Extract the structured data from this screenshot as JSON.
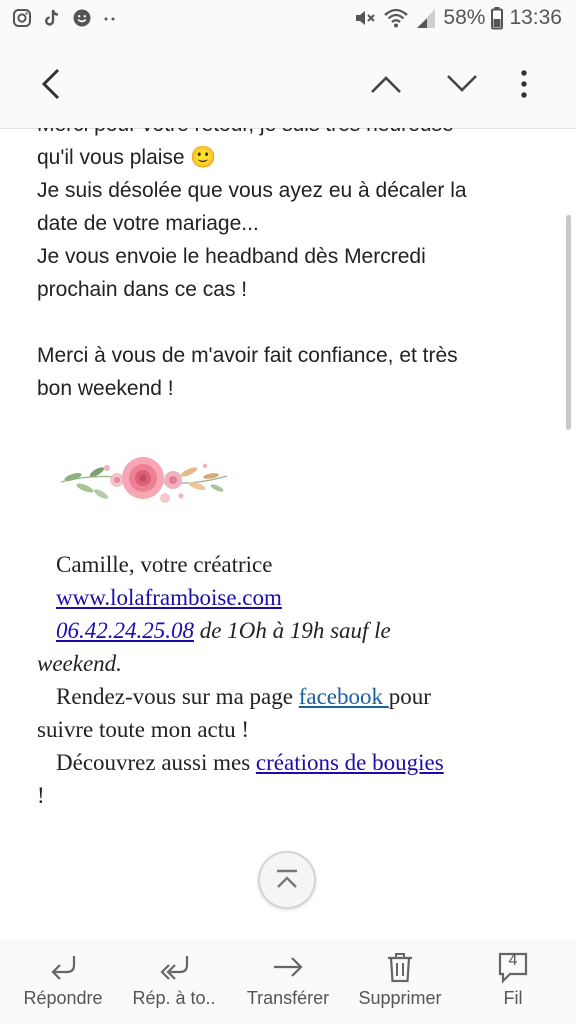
{
  "status_bar": {
    "battery": "58%",
    "time": "13:36",
    "left_icons": [
      "instagram-icon",
      "tiktok-icon",
      "waze-icon",
      "more-dots-icon"
    ],
    "right_icons": [
      "mute-icon",
      "wifi-icon",
      "signal-icon",
      "battery-icon"
    ]
  },
  "toolbar": {
    "icons": [
      "back-arrow-icon",
      "chevron-up-icon",
      "chevron-down-icon",
      "more-vert-icon"
    ]
  },
  "email": {
    "line_partial": "Merci pour votre retour, je suis très heureuse",
    "line1": "qu'il vous plaise 🙂",
    "line2": "Je suis désolée que vous ayez eu à décaler la",
    "line3": "date de votre mariage...",
    "line4": "Je vous envoie le headband dès Mercredi",
    "line5": "prochain dans ce cas !",
    "line6": "Merci à vous de m'avoir fait confiance, et très",
    "line7": "bon weekend !"
  },
  "signature": {
    "name": "Camille, votre créatrice",
    "website": "www.lolaframboise.com",
    "phone": "06.42.24.25.08",
    "hours": " de 1Oh à 19h sauf le",
    "hours_end": "weekend.",
    "fb_pre": "Rendez-vous sur ma page ",
    "fb_link": "facebook ",
    "fb_post": "pour",
    "fb_end": "suivre toute mon actu !",
    "candles_pre": "Découvrez aussi mes ",
    "candles_link": "créations de bougies",
    "candles_end": "!"
  },
  "bottom_bar": {
    "reply": "Répondre",
    "reply_all": "Rép. à to..",
    "forward": "Transférer",
    "delete": "Supprimer",
    "thread": "Fil",
    "thread_count": "4"
  },
  "colors": {
    "link": "#1a0dab",
    "facebook_link": "#1a5fa0",
    "icon_gray": "#555555"
  }
}
